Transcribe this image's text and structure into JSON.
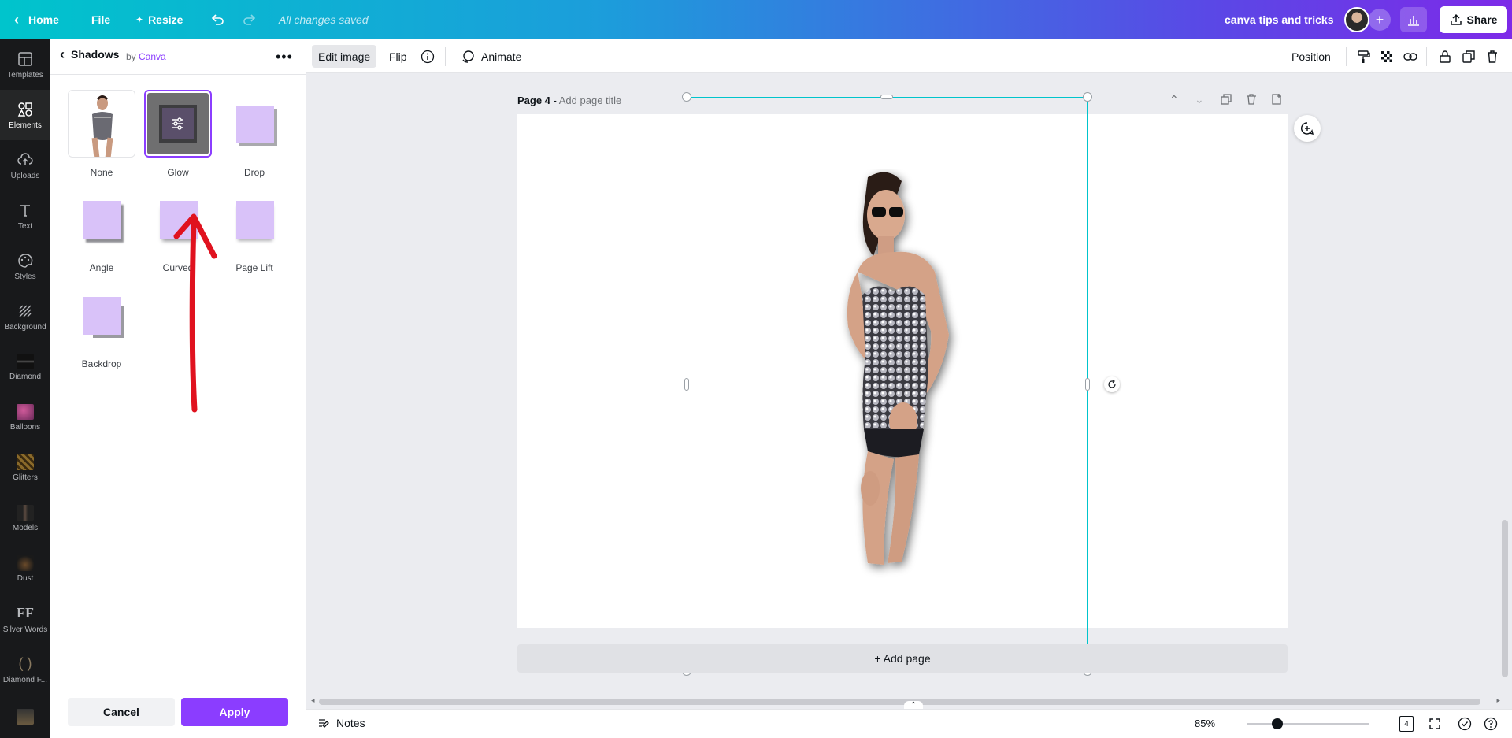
{
  "topbar": {
    "home_label": "Home",
    "file_label": "File",
    "resize_label": "Resize",
    "save_status": "All changes saved",
    "design_title": "canva tips and tricks",
    "share_label": "Share"
  },
  "rail": {
    "items": [
      {
        "label": "Templates",
        "icon": "templates-icon"
      },
      {
        "label": "Elements",
        "icon": "elements-icon"
      },
      {
        "label": "Uploads",
        "icon": "uploads-icon"
      },
      {
        "label": "Text",
        "icon": "text-icon"
      },
      {
        "label": "Styles",
        "icon": "styles-icon"
      },
      {
        "label": "Background",
        "icon": "background-icon"
      },
      {
        "label": "Diamond",
        "icon": "folder-thumb"
      },
      {
        "label": "Balloons",
        "icon": "folder-thumb"
      },
      {
        "label": "Glitters",
        "icon": "folder-thumb"
      },
      {
        "label": "Models",
        "icon": "folder-thumb"
      },
      {
        "label": "Dust",
        "icon": "folder-thumb"
      },
      {
        "label": "Silver Words",
        "icon": "folder-thumb"
      },
      {
        "label": "Diamond F...",
        "icon": "folder-thumb"
      }
    ],
    "active_index": 1
  },
  "panel": {
    "title": "Shadows",
    "by_prefix": "by",
    "by_link": "Canva",
    "effects": [
      {
        "label": "None"
      },
      {
        "label": "Glow"
      },
      {
        "label": "Drop"
      },
      {
        "label": "Angle"
      },
      {
        "label": "Curved"
      },
      {
        "label": "Page Lift"
      },
      {
        "label": "Backdrop"
      }
    ],
    "selected": "Glow",
    "cancel_label": "Cancel",
    "apply_label": "Apply",
    "accent_color": "#8b3dff"
  },
  "toolbar": {
    "edit_image_label": "Edit image",
    "flip_label": "Flip",
    "animate_label": "Animate",
    "position_label": "Position"
  },
  "canvas": {
    "page_label": "Page 4 -",
    "page_title_placeholder": "Add page title",
    "add_page_label": "+ Add page"
  },
  "bottombar": {
    "notes_label": "Notes",
    "zoom_label": "85%",
    "zoom_value": 85,
    "page_count": "4"
  }
}
